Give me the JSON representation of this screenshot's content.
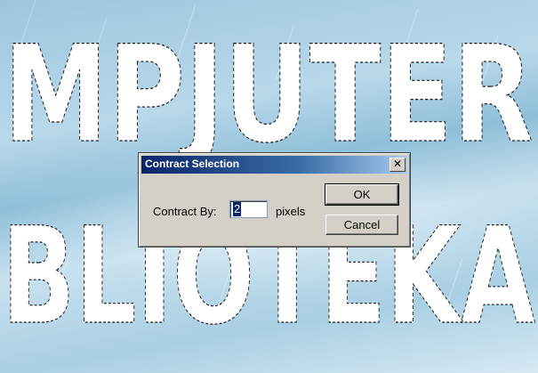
{
  "canvas": {
    "line1": "MPJUTER",
    "line2": "BLIOTEKA"
  },
  "dialog": {
    "title": "Contract Selection",
    "close_glyph": "✕",
    "contract_label": "Contract By:",
    "contract_value": "2",
    "units": "pixels",
    "ok_label": "OK",
    "cancel_label": "Cancel"
  },
  "colors": {
    "titlebar_start": "#0a246a",
    "titlebar_end": "#a6caf0",
    "dialog_face": "#d4d0c8",
    "background_sky": "#a9cfe3"
  }
}
